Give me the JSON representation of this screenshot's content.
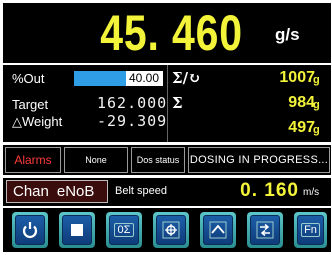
{
  "rate": {
    "value": "45. 460",
    "unit": "g/s"
  },
  "outputs": {
    "pct_out_label": "%Out",
    "pct_out_value": "40.00",
    "pct_out_fraction": 0.58,
    "target_label": "Target",
    "target_value": "162.000",
    "delta_weight_label": "△Weight",
    "delta_weight_value": "-29.309"
  },
  "totals": {
    "total_reset_symbol": "Σ/↻",
    "total_reset_value": "1007",
    "total_symbol": "Σ",
    "total_value": "984",
    "third_value": "497",
    "unit": "g"
  },
  "alarm_row": {
    "alarms_label": "Alarms",
    "none_label": "None",
    "dos_status_label": "Dos status",
    "dosing_status": "DOSING IN PROGRESS..."
  },
  "channel_row": {
    "chan_label": "Chan",
    "chan_name": "eNoB",
    "belt_label": "Belt speed",
    "belt_value": "0. 160",
    "belt_unit": "m/s"
  },
  "buttons": [
    {
      "name": "restart",
      "icon": "restart-icon"
    },
    {
      "name": "stop",
      "icon": "stop-icon"
    },
    {
      "name": "zero-total",
      "icon": "zero-sigma-icon",
      "label": "0Σ"
    },
    {
      "name": "target",
      "icon": "crosshair-icon"
    },
    {
      "name": "up",
      "icon": "chevron-up-icon"
    },
    {
      "name": "exit",
      "icon": "exit-icon"
    },
    {
      "name": "fn",
      "icon": "function-icon",
      "label": "Fn"
    }
  ],
  "colors": {
    "accent_yellow": "#f3f43a",
    "alarm_red": "#ff3a3a",
    "bar_blue": "#2f9ee6",
    "button_blue": "#1c5ea8",
    "button_rim": "#3fb0b2"
  }
}
